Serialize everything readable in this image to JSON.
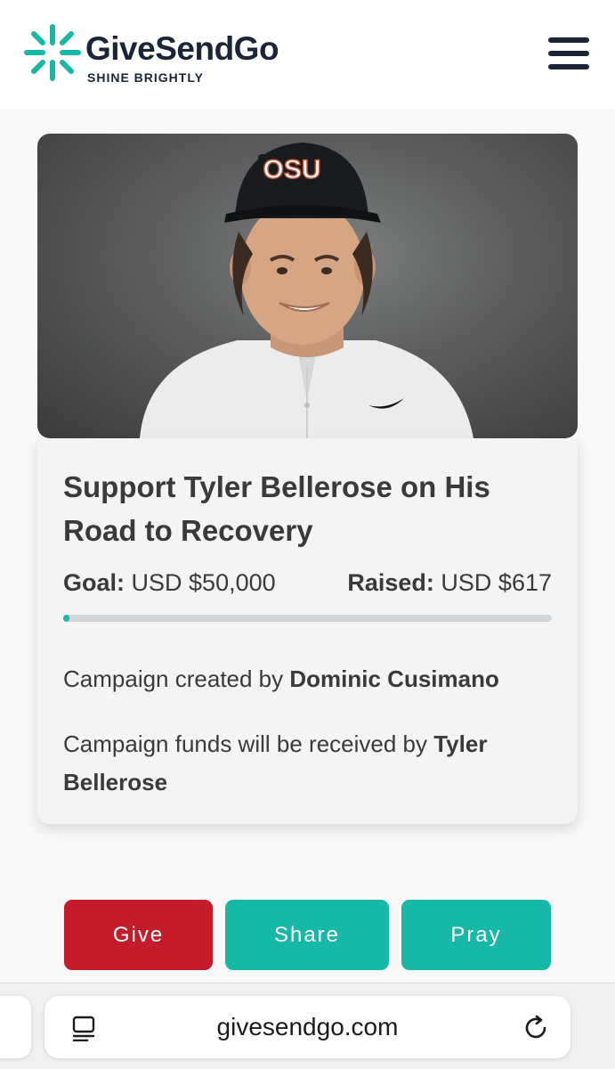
{
  "header": {
    "brand_name": "GiveSendGo",
    "tagline": "SHINE BRIGHTLY",
    "logo_icon": "starburst-icon",
    "menu_icon": "hamburger-menu-icon",
    "brand_color": "#1b2536",
    "accent_color": "#18b8a6"
  },
  "campaign": {
    "image_alt": "Campaign photo",
    "title": "Support Tyler Bellerose on His Road to Recovery",
    "goal_label": "Goal:",
    "goal_value": "USD $50,000",
    "raised_label": "Raised:",
    "raised_value": "USD $617",
    "progress_percent": 1.2,
    "created_prefix": "Campaign created by",
    "creator": "Dominic Cusimano",
    "funds_prefix": "Campaign funds will be received by",
    "beneficiary": "Tyler Bellerose"
  },
  "actions": {
    "give_label": "Give",
    "share_label": "Share",
    "pray_label": "Pray",
    "give_color": "#c41c2b",
    "share_color": "#18b8a6",
    "pray_color": "#18b8a6"
  },
  "browser": {
    "url": "givesendgo.com",
    "reader_icon": "reader-mode-icon",
    "reload_icon": "reload-icon"
  }
}
